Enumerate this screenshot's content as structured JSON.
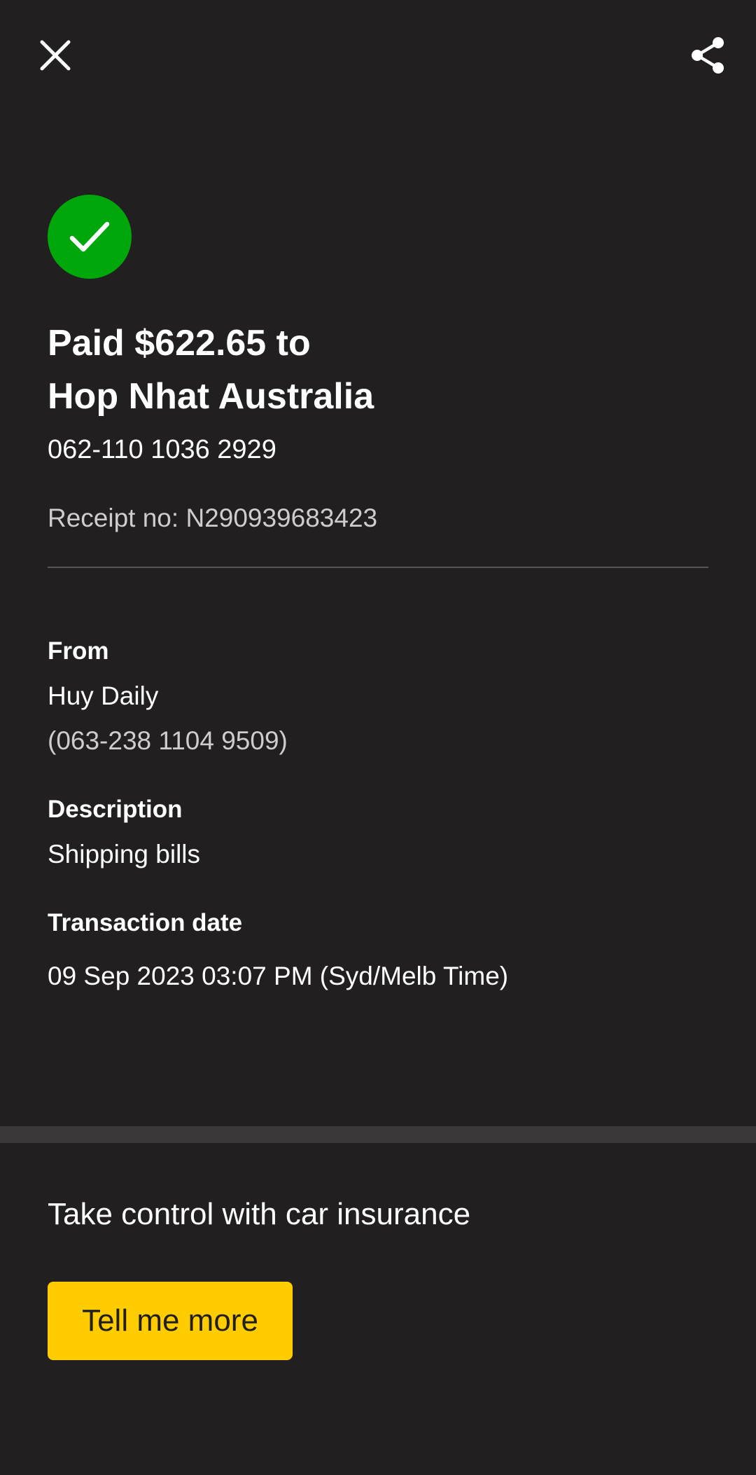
{
  "header": {
    "close_icon": "close-icon",
    "share_icon": "share-icon"
  },
  "status": {
    "icon": "checkmark-icon",
    "color": "#00a70a"
  },
  "payment": {
    "title_line1": "Paid $622.65 to",
    "title_line2": "Hop Nhat Australia",
    "account": "062-110 1036 2929",
    "receipt": "Receipt no: N290939683423"
  },
  "details": {
    "from_label": "From",
    "from_name": "Huy Daily",
    "from_account": "(063-238 1104 9509)",
    "description_label": "Description",
    "description_value": "Shipping bills",
    "date_label": "Transaction date",
    "date_value": "09 Sep 2023 03:07 PM (Syd/Melb Time)"
  },
  "promo": {
    "text": "Take control with car insurance",
    "button_label": "Tell me more",
    "button_color": "#ffcc00"
  },
  "theme": {
    "background": "#221f20",
    "band": "#3b3839"
  }
}
